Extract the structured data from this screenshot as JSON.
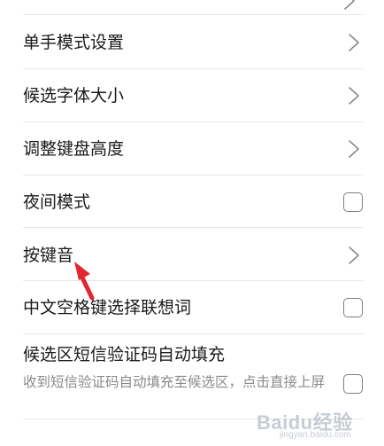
{
  "settings": {
    "items": [
      {
        "title": "单手模式设置",
        "control": "chevron"
      },
      {
        "title": "候选字体大小",
        "control": "chevron"
      },
      {
        "title": "调整键盘高度",
        "control": "chevron"
      },
      {
        "title": "夜间模式",
        "control": "checkbox",
        "checked": false
      },
      {
        "title": "按键音",
        "control": "chevron"
      },
      {
        "title": "中文空格键选择联想词",
        "control": "checkbox",
        "checked": false
      },
      {
        "title": "候选区短信验证码自动填充",
        "description": "收到短信验证码自动填充至候选区，点击直接上屏",
        "control": "checkbox",
        "checked": false
      }
    ]
  },
  "annotation": {
    "arrow_color": "#e0282e",
    "points_to": "按键音"
  },
  "watermark": {
    "text": "Baidu经验",
    "sub": "jingyan.baidu.com"
  },
  "colors": {
    "background": "#ffffff",
    "title_text": "#1a1a1a",
    "description_text": "#8a8a8a",
    "divider": "#e6e6e6",
    "control_stroke": "#7d7d7d"
  }
}
